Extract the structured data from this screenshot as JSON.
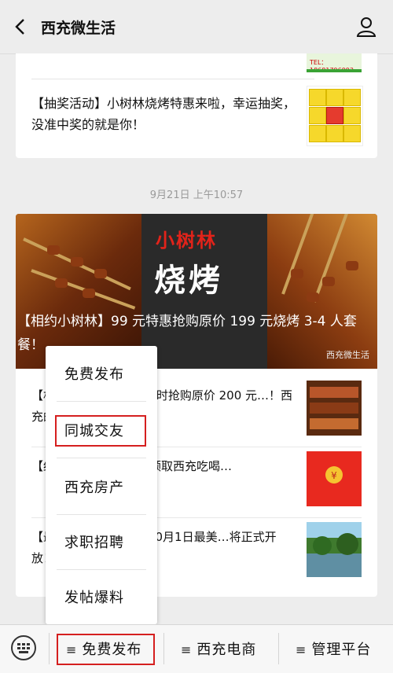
{
  "header": {
    "title": "西充微生活"
  },
  "card1": {
    "tel": "TEL：18681796993",
    "text": "【抽奖活动】小树林烧烤特惠来啦，幸运抽奖，没准中奖的就是你！"
  },
  "timestamp": "9月21日 上午10:57",
  "card2": {
    "logo_top": "小树林",
    "logo_main": "烧烤",
    "banner_title": "【相约小树林】99 元特惠抢购原价 199 元烧烤 3-4 人套餐！",
    "watermark": "西充微生活",
    "items": [
      {
        "text": "【相约小树林】99 元限时抢购原价 200 元…！西充的夜生活…"
      },
      {
        "text": "【红包福利】网友尽快领取西充吃喝…"
      },
      {
        "text": "【最新消息】2020 年10月1日最美…将正式开放！"
      }
    ]
  },
  "popup": {
    "items": [
      "免费发布",
      "同城交友",
      "西充房产",
      "求职招聘",
      "发帖爆料"
    ]
  },
  "bottom": {
    "menus": [
      "免费发布",
      "西充电商",
      "管理平台"
    ],
    "menu_icon": "≡"
  },
  "colors": {
    "highlight": "#d51f1f",
    "background": "#ededed"
  }
}
